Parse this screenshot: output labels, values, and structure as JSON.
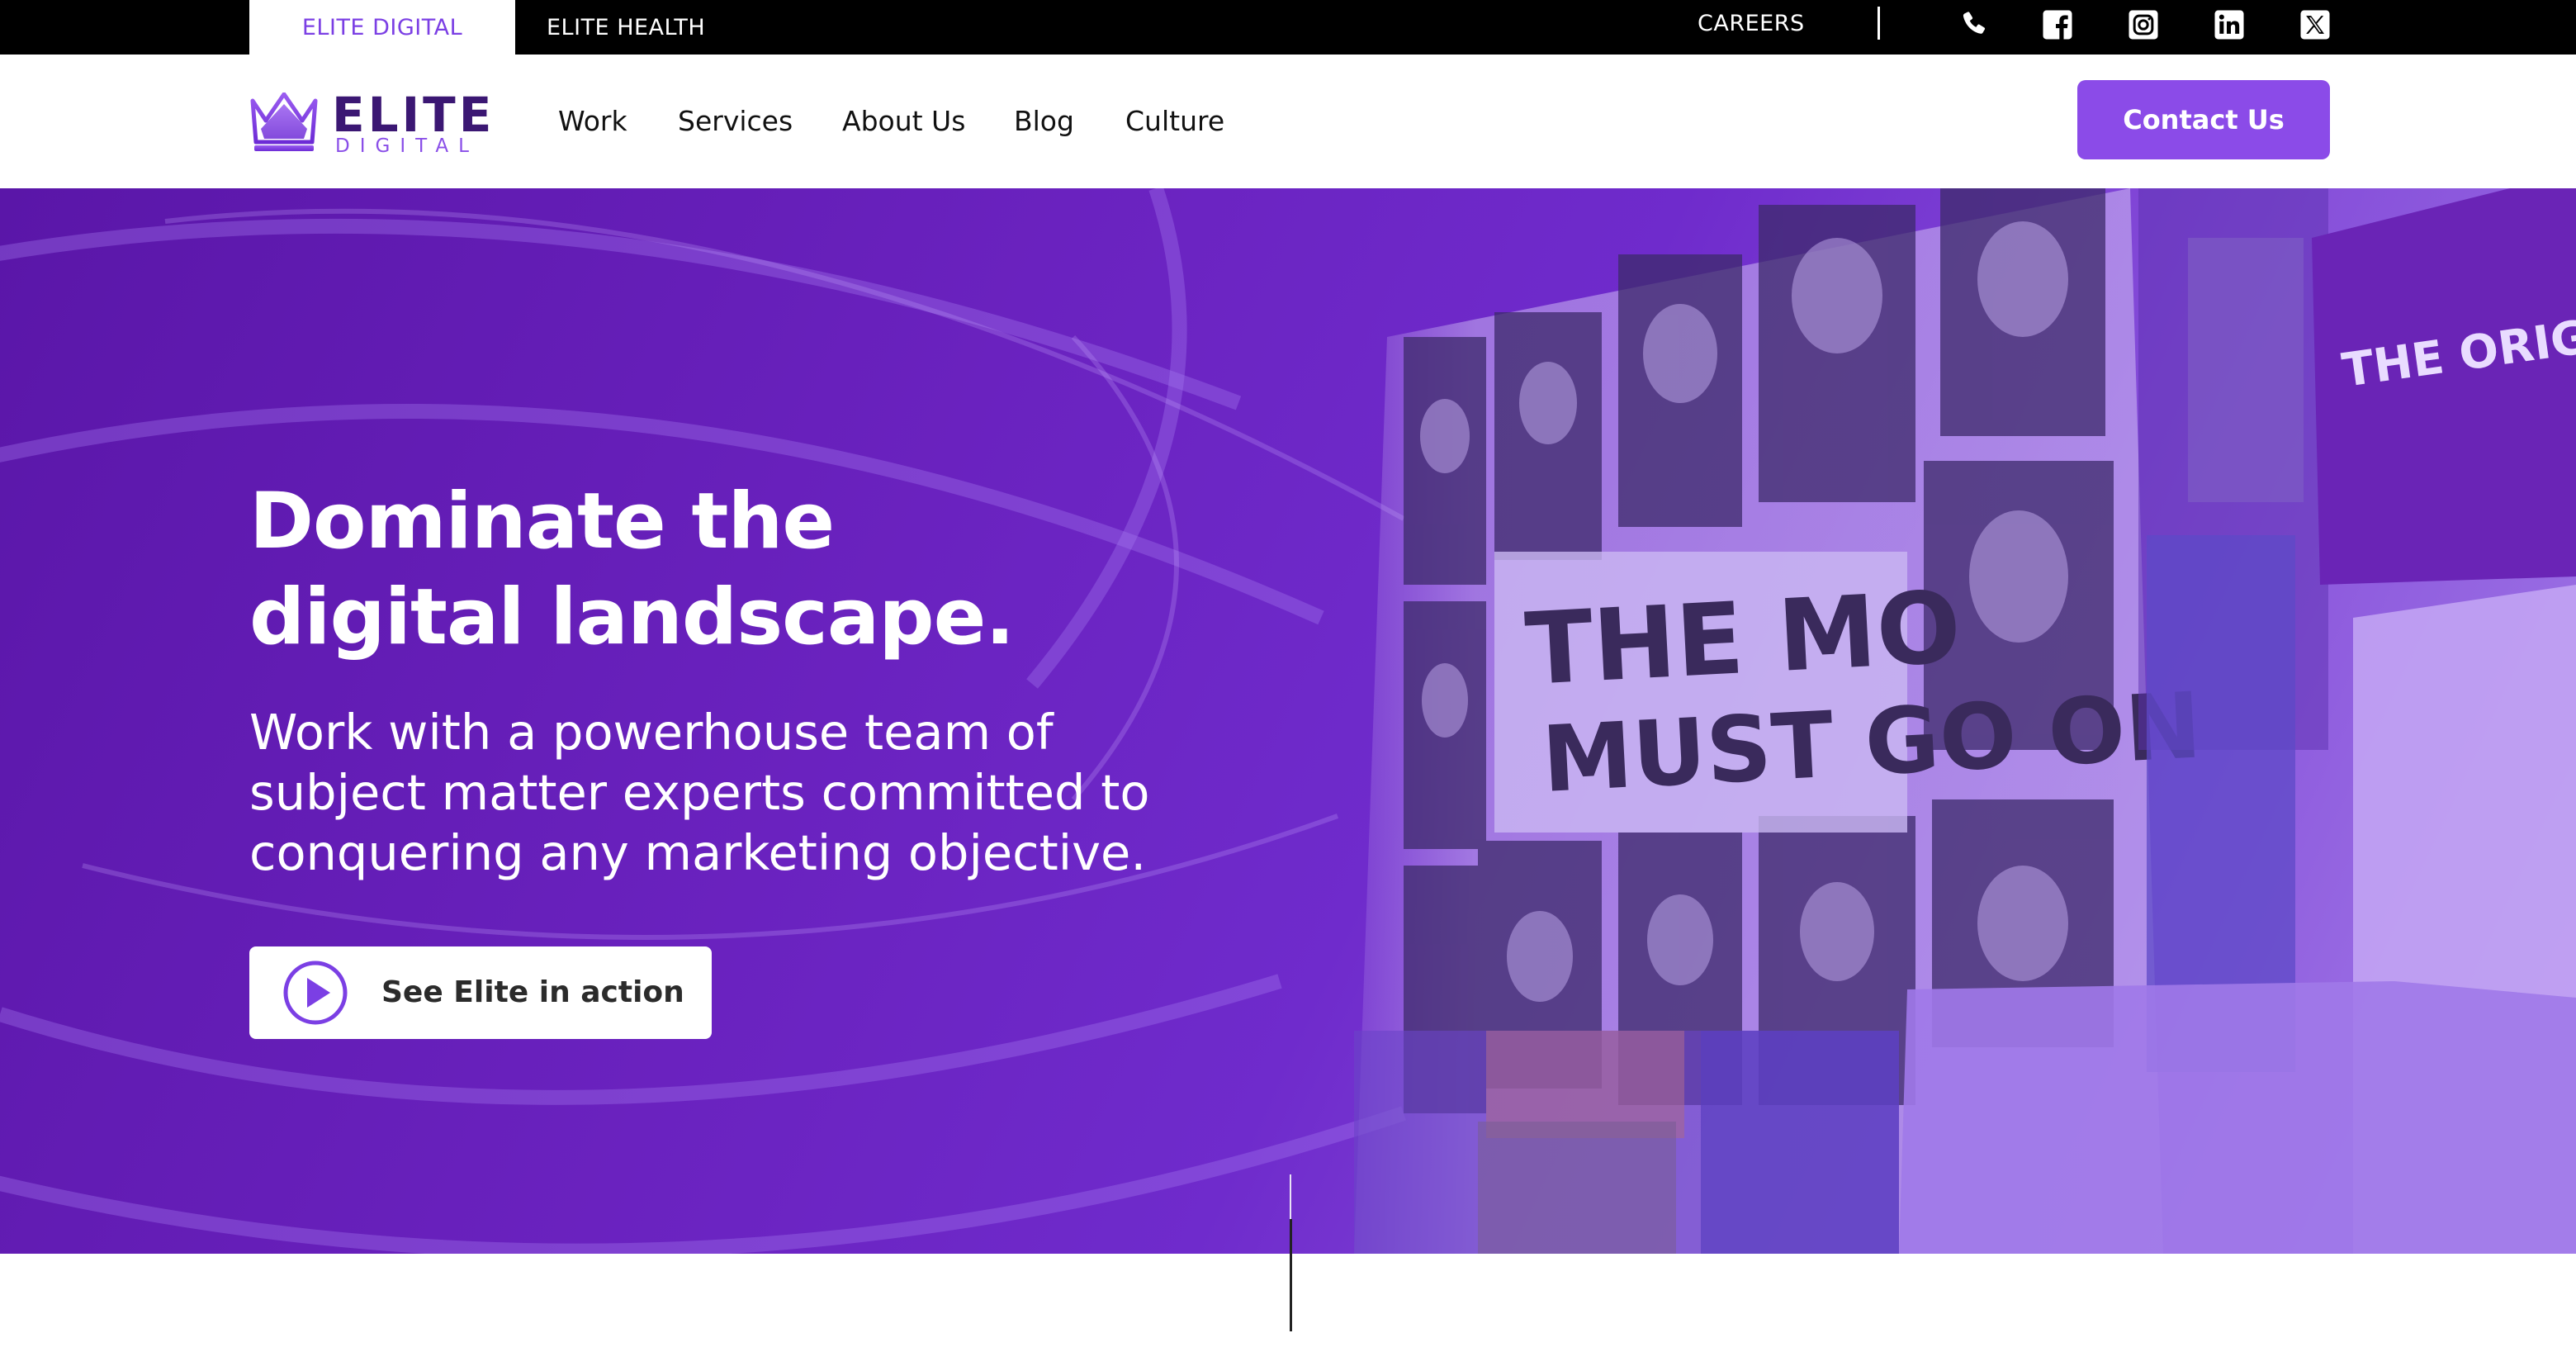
{
  "topbar": {
    "brands": [
      "ELITE DIGITAL",
      "ELITE HEALTH"
    ],
    "careers": "CAREERS",
    "social_icons": [
      "phone-icon",
      "facebook-icon",
      "instagram-icon",
      "linkedin-icon",
      "x-icon"
    ]
  },
  "nav": {
    "logo": {
      "word": "ELITE",
      "sub": "DIGITAL"
    },
    "links": [
      "Work",
      "Services",
      "About Us",
      "Blog",
      "Culture"
    ],
    "contact_label": "Contact Us"
  },
  "hero": {
    "headline_line1": "Dominate the",
    "headline_line2": "digital landscape.",
    "subhead": "Work with a powerhouse team of subject matter experts committed to conquering any marketing objective.",
    "cta_label": "See Elite in action",
    "image_sign_text": [
      "THE ORIGINAL",
      "THE MO",
      "MUST GO ON"
    ]
  },
  "colors": {
    "accent": "#8b4be8",
    "logo_dark": "#3b1773",
    "hero_purple": "#6a22bf",
    "topbar": "#000000"
  }
}
